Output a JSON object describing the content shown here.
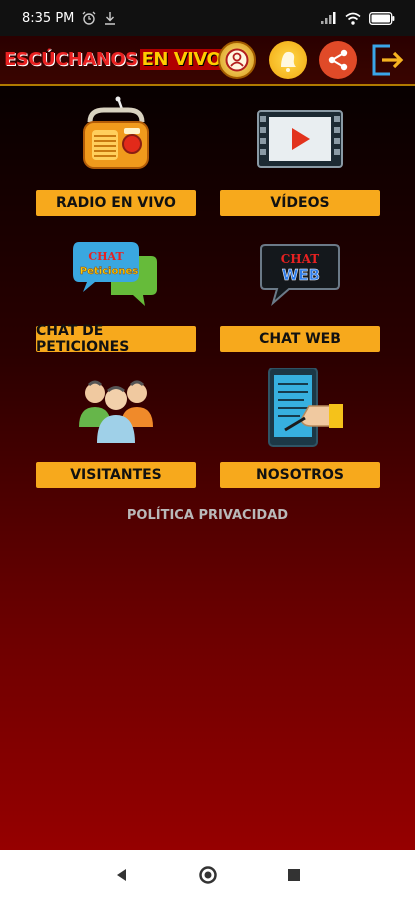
{
  "status_bar": {
    "time": "8:35 PM"
  },
  "app": {
    "logo_part1": "ESCÚCHANOS",
    "logo_part2": "EN VIVO"
  },
  "menu": [
    {
      "label": "RADIO EN VIVO",
      "icon": "radio-icon"
    },
    {
      "label": "VÍDEOS",
      "icon": "video-player-icon"
    },
    {
      "label": "CHAT DE PETICIONES",
      "icon": "chat-bubbles-icon",
      "icon_text1": "CHAT",
      "icon_text2": "Peticiones"
    },
    {
      "label": "CHAT WEB",
      "icon": "chat-web-icon",
      "icon_text1": "CHAT",
      "icon_text2": "WEB"
    },
    {
      "label": "VISITANTES",
      "icon": "people-group-icon"
    },
    {
      "label": "NOSOTROS",
      "icon": "tablet-writing-icon"
    }
  ],
  "privacy_label": "POLÍTICA PRIVACIDAD",
  "colors": {
    "accent": "#f7a91c",
    "header_border": "#b07a00",
    "background_top": "#070000",
    "background_bottom": "#960000"
  }
}
